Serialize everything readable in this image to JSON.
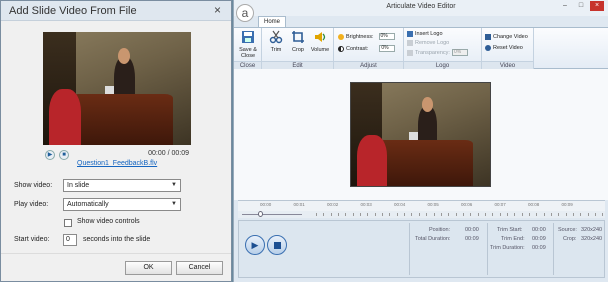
{
  "dialog": {
    "title": "Add Slide Video From File",
    "close_glyph": "×",
    "time": "00:00 / 00:09",
    "filename": "Question1_FeedbackB.flv",
    "show_video_label": "Show video:",
    "show_video_value": "In slide",
    "play_video_label": "Play video:",
    "play_video_value": "Automatically",
    "show_controls_label": "Show video controls",
    "show_controls_checked": false,
    "start_video_label": "Start video:",
    "start_video_value": "0",
    "start_video_suffix": "seconds into the slide",
    "ok_label": "OK",
    "cancel_label": "Cancel",
    "play_icon": "▶",
    "stop_icon": "■"
  },
  "editor": {
    "title": "Articulate Video Editor",
    "logo_glyph": "a",
    "tab_home": "Home",
    "window_controls": {
      "min": "–",
      "max": "□",
      "close": "×"
    },
    "groups": {
      "close": {
        "label": "Close",
        "save_close": "Save & Close"
      },
      "edit": {
        "label": "Edit",
        "trim": "Trim",
        "crop": "Crop",
        "volume": "Volume"
      },
      "adjust": {
        "label": "Adjust",
        "brightness_label": "Brightness:",
        "brightness_value": "0%",
        "contrast_label": "Contrast:",
        "contrast_value": "0%"
      },
      "logo": {
        "label": "Logo",
        "insert": "Insert Logo",
        "remove": "Remove Logo",
        "transparency_label": "Transparency:",
        "transparency_value": "0%"
      },
      "video": {
        "label": "Video",
        "change": "Change Video",
        "reset": "Reset Video"
      }
    },
    "timeline_ticks": [
      "00:00",
      "00:01",
      "00:02",
      "00:03",
      "00:04",
      "00:05",
      "00:06",
      "00:07",
      "00:08",
      "00:09"
    ],
    "info": {
      "position_label": "Position:",
      "position_value": "00:00",
      "total_label": "Total Duration:",
      "total_value": "00:09",
      "trim_start_label": "Trim Start:",
      "trim_start_value": "00:00",
      "trim_end_label": "Trim End:",
      "trim_end_value": "00:09",
      "trim_dur_label": "Trim Duration:",
      "trim_dur_value": "00:09",
      "source_label": "Source:",
      "source_value": "320x240",
      "crop_label": "Crop:",
      "crop_value": "320x240"
    },
    "play_icon": "▶"
  },
  "colors": {
    "accent": "#1f5f9a",
    "link": "#1565c0",
    "close_red": "#c7332c"
  }
}
